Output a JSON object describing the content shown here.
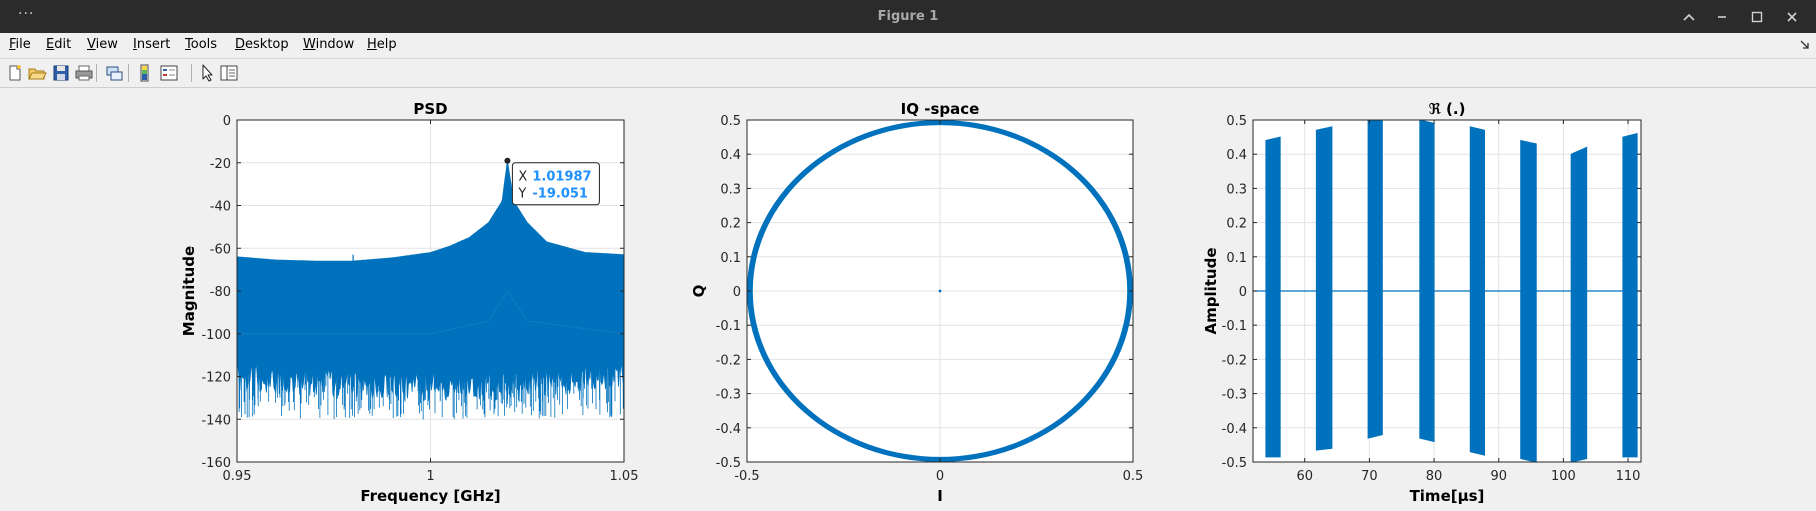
{
  "window": {
    "title": "Figure 1",
    "menu_dots": "···",
    "menu": [
      {
        "pre": "",
        "ul": "F",
        "post": "ile"
      },
      {
        "pre": "",
        "ul": "E",
        "post": "dit"
      },
      {
        "pre": "",
        "ul": "V",
        "post": "iew"
      },
      {
        "pre": "",
        "ul": "I",
        "post": "nsert"
      },
      {
        "pre": "",
        "ul": "T",
        "post": "ools"
      },
      {
        "pre": "",
        "ul": "D",
        "post": "esktop"
      },
      {
        "pre": "",
        "ul": "W",
        "post": "indow"
      },
      {
        "pre": "",
        "ul": "H",
        "post": "elp"
      }
    ],
    "toolbar_icons": [
      "new-figure-icon",
      "open-file-icon",
      "save-icon",
      "print-icon",
      "link-icon",
      "colorbar-icon",
      "legend-icon",
      "pointer-icon",
      "property-inspector-icon"
    ]
  },
  "colors": {
    "series": "#0072bd",
    "datatip_value": "#1e90ff"
  },
  "chart_data": [
    {
      "type": "line",
      "title": "PSD",
      "xlabel": "Frequency [GHz]",
      "ylabel": "Magnitude",
      "xlim": [
        0.95,
        1.05
      ],
      "ylim": [
        -160,
        0
      ],
      "xticks": [
        0.95,
        1,
        1.05
      ],
      "xticklabels": [
        "0.95",
        "1",
        "1.05"
      ],
      "yticks": [
        0,
        -20,
        -40,
        -60,
        -80,
        -100,
        -120,
        -140,
        -160
      ],
      "yticklabels": [
        "0",
        "-20",
        "-40",
        "-60",
        "-80",
        "-100",
        "-120",
        "-140",
        "-160"
      ],
      "grid": true,
      "series": [
        {
          "upper_envelope": {
            "x": [
              0.95,
              0.96,
              0.97,
              0.98,
              0.99,
              1.0,
              1.005,
              1.01,
              1.015,
              1.0185,
              1.01987,
              1.0215,
              1.025,
              1.03,
              1.04,
              1.05
            ],
            "y": [
              -64,
              -65.5,
              -66,
              -66,
              -64.5,
              -62,
              -59,
              -55,
              -48,
              -38,
              -19.051,
              -38,
              -48,
              -57,
              -62,
              -63
            ]
          },
          "median_level": {
            "x": [
              0.95,
              1.0,
              1.015,
              1.01987,
              1.025,
              1.05
            ],
            "y": [
              -80,
              -80,
              -74,
              -60,
              -74,
              -80
            ]
          },
          "lower_noise_floor": {
            "x": [
              0.95,
              1.0,
              1.05
            ],
            "y": [
              -120,
              -125,
              -120
            ]
          },
          "spike_min": -142
        }
      ],
      "datatip": {
        "x_label": "X",
        "x": "1.01987",
        "y_label": "Y",
        "y": "-19.051",
        "point": [
          1.01987,
          -19.051
        ]
      }
    },
    {
      "type": "scatter",
      "title": "IQ -space",
      "xlabel": "I",
      "ylabel": "Q",
      "xlim": [
        -0.5,
        0.5
      ],
      "ylim": [
        -0.5,
        0.5
      ],
      "xticks": [
        -0.5,
        0,
        0.5
      ],
      "xticklabels": [
        "-0.5",
        "0",
        "0.5"
      ],
      "yticks": [
        0.5,
        0.4,
        0.3,
        0.2,
        0.1,
        0,
        -0.1,
        -0.2,
        -0.3,
        -0.4,
        -0.5
      ],
      "yticklabels": [
        "0.5",
        "0.4",
        "0.3",
        "0.2",
        "0.1",
        "0",
        "-0.1",
        "-0.2",
        "-0.3",
        "-0.4",
        "-0.5"
      ],
      "grid": true,
      "series": [
        {
          "shape": "circle",
          "center": [
            0,
            0
          ],
          "radius_range": [
            0.485,
            0.5
          ],
          "extra_point": [
            0,
            0
          ]
        }
      ]
    },
    {
      "type": "line",
      "title": "ℜ (.)",
      "xlabel": "Time[μs]",
      "ylabel": "Amplitude",
      "xlim": [
        52,
        112
      ],
      "ylim": [
        -0.5,
        0.5
      ],
      "xticks": [
        60,
        70,
        80,
        90,
        100,
        110
      ],
      "xticklabels": [
        "60",
        "70",
        "80",
        "90",
        "100",
        "110"
      ],
      "yticks": [
        0.5,
        0.4,
        0.3,
        0.2,
        0.1,
        0,
        -0.1,
        -0.2,
        -0.3,
        -0.4,
        -0.5
      ],
      "yticklabels": [
        "0.5",
        "0.4",
        "0.3",
        "0.2",
        "0.1",
        "0",
        "-0.1",
        "-0.2",
        "-0.3",
        "-0.4",
        "-0.5"
      ],
      "grid": true,
      "series": [
        {
          "baseline": 0,
          "bursts": [
            {
              "x0": 54.0,
              "x1": 56.2,
              "top": [
                0.44,
                0.45
              ],
              "bot": [
                -0.485,
                -0.485
              ]
            },
            {
              "x0": 61.8,
              "x1": 64.2,
              "top": [
                0.47,
                0.48
              ],
              "bot": [
                -0.465,
                -0.46
              ]
            },
            {
              "x0": 69.8,
              "x1": 72.0,
              "top": [
                0.5,
                0.5
              ],
              "bot": [
                -0.43,
                -0.42
              ]
            },
            {
              "x0": 77.8,
              "x1": 80.0,
              "top": [
                0.5,
                0.49
              ],
              "bot": [
                -0.43,
                -0.44
              ]
            },
            {
              "x0": 85.6,
              "x1": 87.8,
              "top": [
                0.48,
                0.47
              ],
              "bot": [
                -0.47,
                -0.48
              ]
            },
            {
              "x0": 93.4,
              "x1": 95.8,
              "top": [
                0.44,
                0.43
              ],
              "bot": [
                -0.49,
                -0.5
              ]
            },
            {
              "x0": 101.2,
              "x1": 103.6,
              "top": [
                0.4,
                0.42
              ],
              "bot": [
                -0.5,
                -0.49
              ]
            },
            {
              "x0": 109.2,
              "x1": 111.4,
              "top": [
                0.45,
                0.46
              ],
              "bot": [
                -0.485,
                -0.485
              ]
            }
          ]
        }
      ]
    }
  ]
}
